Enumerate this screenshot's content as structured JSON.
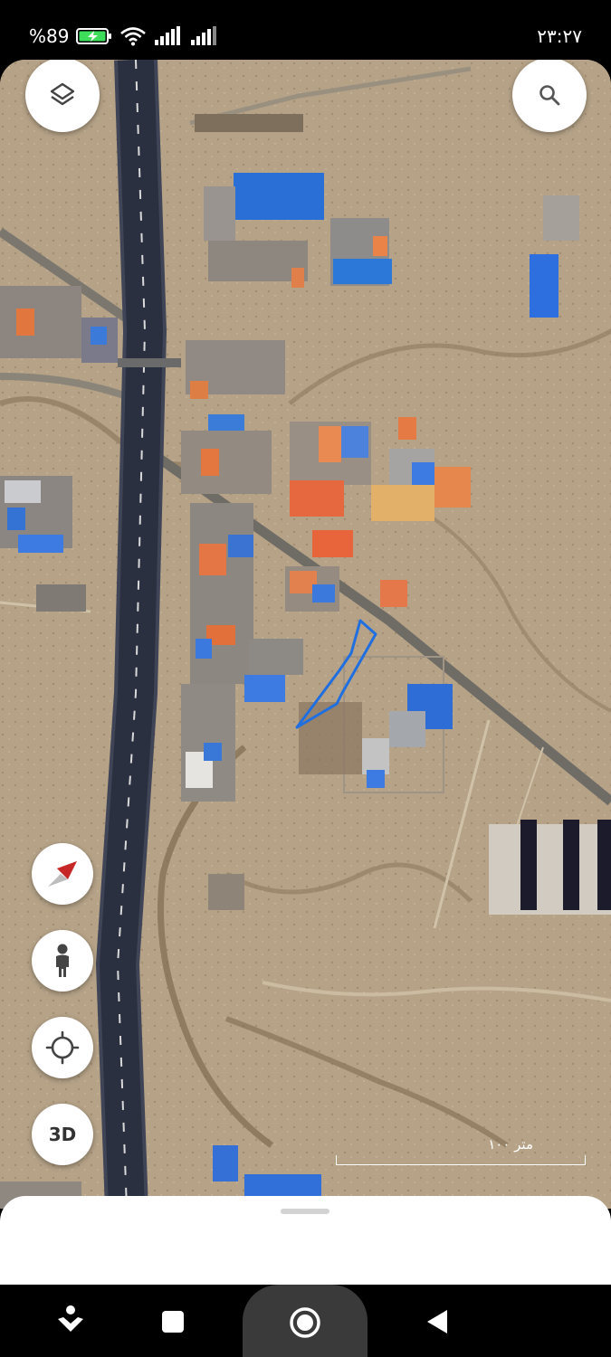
{
  "status_bar": {
    "battery_percent": "%89",
    "time": "۲۳:۲۷",
    "icons": [
      "battery-charging-icon",
      "wifi-icon",
      "signal-icon",
      "signal-icon"
    ]
  },
  "map": {
    "view": "satellite",
    "scale_label": "۱۰۰ متر",
    "parcel_outline_color": "#1f6fe0"
  },
  "controls": {
    "layers_icon": "layers-icon",
    "search_icon": "search-icon",
    "compass_icon": "compass-icon",
    "street_view_icon": "pegman-icon",
    "my_location_icon": "crosshair-icon",
    "three_d_label": "3D"
  },
  "nav_bar": {
    "icons": [
      "assistant-icon",
      "recents-icon",
      "home-icon",
      "back-icon"
    ]
  },
  "colors": {
    "accent": "#1f6fe0",
    "battery": "#3ddc5a",
    "compass_red": "#e53935"
  }
}
